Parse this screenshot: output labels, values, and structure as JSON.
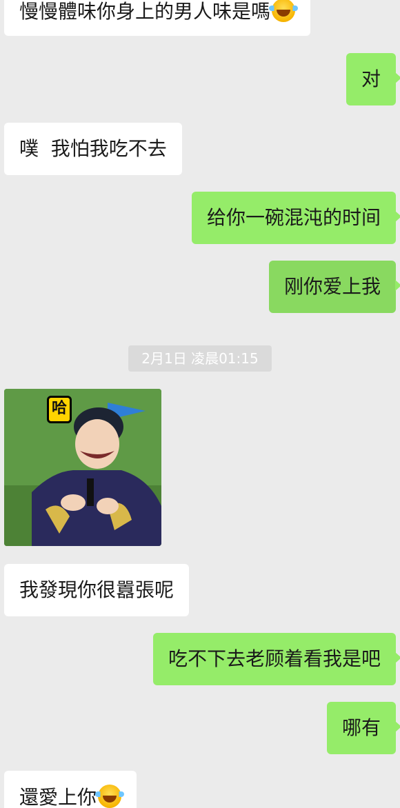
{
  "messages": [
    {
      "text": "慢慢體味你身上的男人味是嗎",
      "emoji": "joy-emoji"
    },
    {
      "text": "对"
    },
    {
      "text": "噗  我怕我吃不去"
    },
    {
      "text": "给你一碗混沌的时间"
    },
    {
      "text": "刚你爱上我"
    },
    {
      "timestamp": "2月1日 凌晨01:15"
    },
    {
      "sticker_label": "哈"
    },
    {
      "text": "我發現你很囂張呢"
    },
    {
      "text": "吃不下去老顾着看我是吧"
    },
    {
      "text": "哪有"
    },
    {
      "text": "還愛上你",
      "emoji": "joy-emoji"
    }
  ],
  "colors": {
    "background": "#ebebeb",
    "outgoing_bubble": "#95ec69",
    "incoming_bubble": "#ffffff",
    "timestamp_bg": "#dadada"
  }
}
